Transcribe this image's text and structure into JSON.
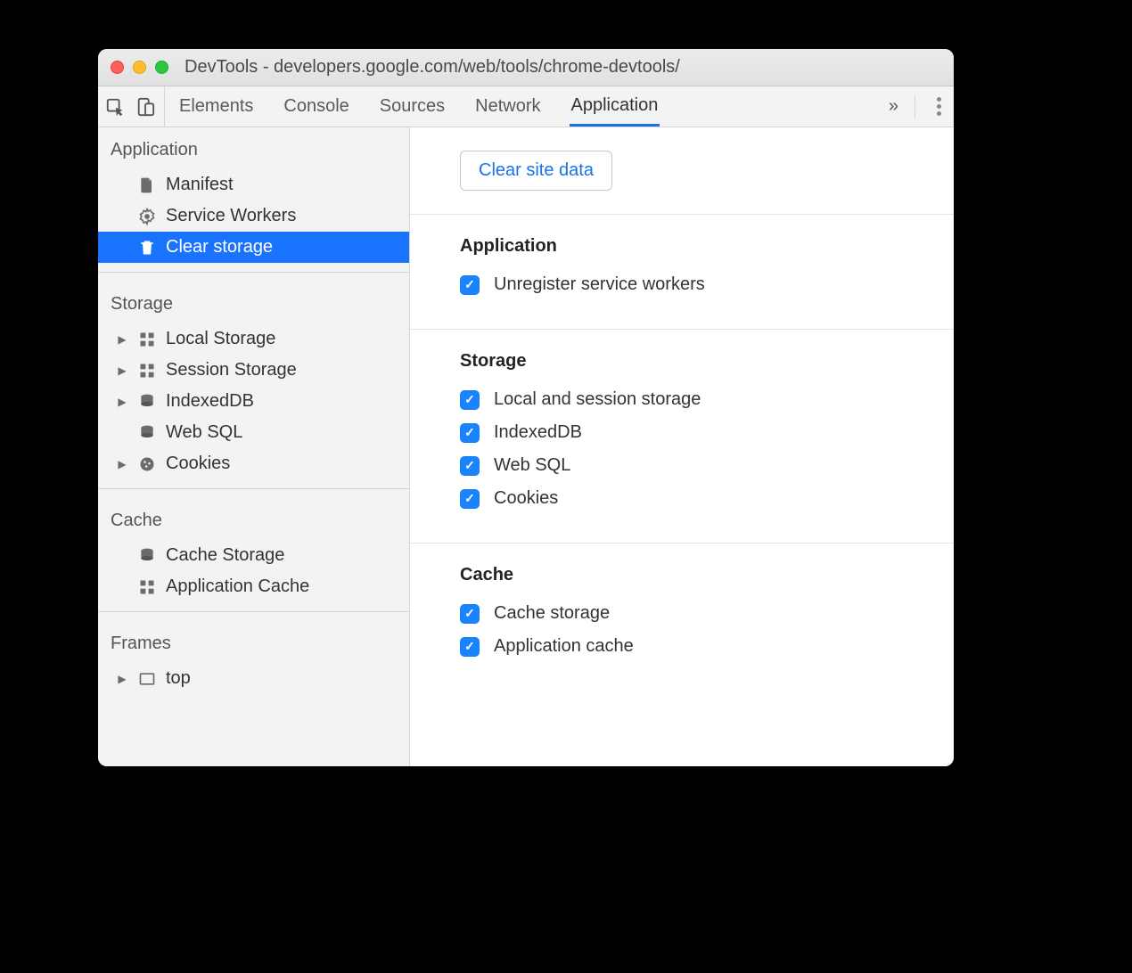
{
  "window": {
    "title": "DevTools - developers.google.com/web/tools/chrome-devtools/"
  },
  "tabs": {
    "items": [
      "Elements",
      "Console",
      "Sources",
      "Network",
      "Application"
    ],
    "active": 4
  },
  "sidebar": {
    "groups": [
      {
        "title": "Application",
        "items": [
          {
            "label": "Manifest",
            "icon": "file-icon",
            "expandable": false
          },
          {
            "label": "Service Workers",
            "icon": "gear-icon",
            "expandable": false
          },
          {
            "label": "Clear storage",
            "icon": "trash-icon",
            "expandable": false,
            "selected": true
          }
        ]
      },
      {
        "title": "Storage",
        "items": [
          {
            "label": "Local Storage",
            "icon": "grid-icon",
            "expandable": true
          },
          {
            "label": "Session Storage",
            "icon": "grid-icon",
            "expandable": true
          },
          {
            "label": "IndexedDB",
            "icon": "database-icon",
            "expandable": true
          },
          {
            "label": "Web SQL",
            "icon": "database-icon",
            "expandable": false
          },
          {
            "label": "Cookies",
            "icon": "cookie-icon",
            "expandable": true
          }
        ]
      },
      {
        "title": "Cache",
        "items": [
          {
            "label": "Cache Storage",
            "icon": "database-icon",
            "expandable": false
          },
          {
            "label": "Application Cache",
            "icon": "grid-icon",
            "expandable": false
          }
        ]
      },
      {
        "title": "Frames",
        "items": [
          {
            "label": "top",
            "icon": "frame-icon",
            "expandable": true
          }
        ]
      }
    ]
  },
  "main": {
    "clear_button": "Clear site data",
    "sections": [
      {
        "title": "Application",
        "checks": [
          {
            "label": "Unregister service workers",
            "checked": true
          }
        ]
      },
      {
        "title": "Storage",
        "checks": [
          {
            "label": "Local and session storage",
            "checked": true
          },
          {
            "label": "IndexedDB",
            "checked": true
          },
          {
            "label": "Web SQL",
            "checked": true
          },
          {
            "label": "Cookies",
            "checked": true
          }
        ]
      },
      {
        "title": "Cache",
        "checks": [
          {
            "label": "Cache storage",
            "checked": true
          },
          {
            "label": "Application cache",
            "checked": true
          }
        ]
      }
    ]
  },
  "colors": {
    "accent": "#1a73e8",
    "select": "#1a73ff",
    "check": "#1a84ff"
  }
}
